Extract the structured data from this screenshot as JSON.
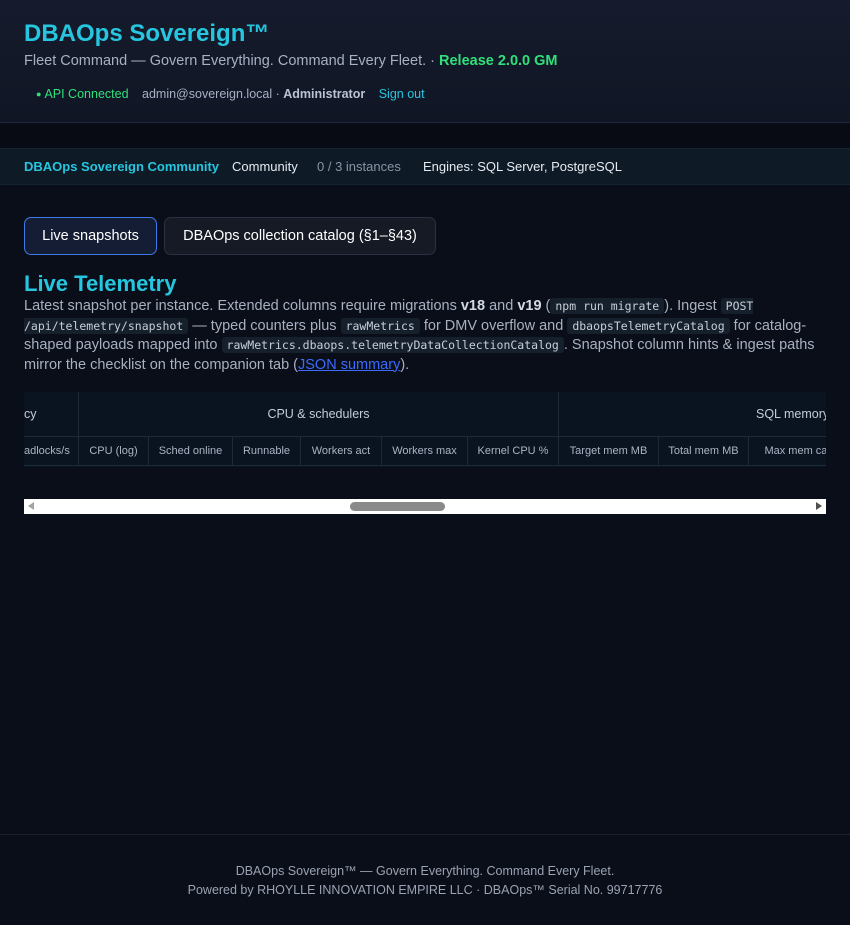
{
  "header": {
    "brand": "DBAOps Sovereign™",
    "tagline": "Fleet Command — Govern Everything. Command Every Fleet. ·",
    "release": "Release 2.0.0 GM",
    "api_status": "API Connected",
    "user_email": "admin@sovereign.local ·",
    "user_role": "Administrator",
    "sign_out": "Sign out"
  },
  "infobar": {
    "name": "DBAOps Sovereign Community",
    "tier": "Community",
    "instances": "0 / 3 instances",
    "engines": "Engines: SQL Server, PostgreSQL"
  },
  "tabs": [
    {
      "label": "Live snapshots",
      "active": true
    },
    {
      "label": "DBAOps collection catalog (§1–§43)",
      "active": false
    }
  ],
  "section": {
    "title": "Live Telemetry",
    "desc": {
      "t1": "Latest snapshot per instance. Extended columns require migrations ",
      "v18": "v18",
      "t2": " and ",
      "v19": "v19",
      "t3": " (",
      "c1": "npm run migrate",
      "t4": "). Ingest ",
      "c2": "POST /api/telemetry/snapshot",
      "t5": " — typed counters plus ",
      "c3": "rawMetrics",
      "t6": " for DMV overflow and ",
      "c4": "dbaopsTelemetryCatalog",
      "t7": " for catalog-shaped payloads mapped into ",
      "c5": "rawMetrics.dbaops.telemetryDataCollectionCatalog",
      "t8": ". Snapshot column hints & ingest paths mirror the checklist on the companion tab (",
      "link": "JSON summary",
      "t9": ")."
    }
  },
  "table": {
    "groups": [
      "cy",
      "CPU & schedulers",
      "SQL memory"
    ],
    "columns": [
      "adlocks/s",
      "CPU (log)",
      "Sched online",
      "Runnable",
      "Workers act",
      "Workers max",
      "Kernel CPU %",
      "Target mem MB",
      "Total mem MB",
      "Max mem cap"
    ]
  },
  "footer": {
    "line1": "DBAOps Sovereign™ — Govern Everything. Command Every Fleet.",
    "line2": "Powered by RHOYLLE INNOVATION EMPIRE LLC · DBAOps™ Serial No. 99717776"
  },
  "colors": {
    "accent": "#26c6e0",
    "success": "#2fe07a",
    "background": "#0a0e18",
    "link": "#3b6bff"
  }
}
